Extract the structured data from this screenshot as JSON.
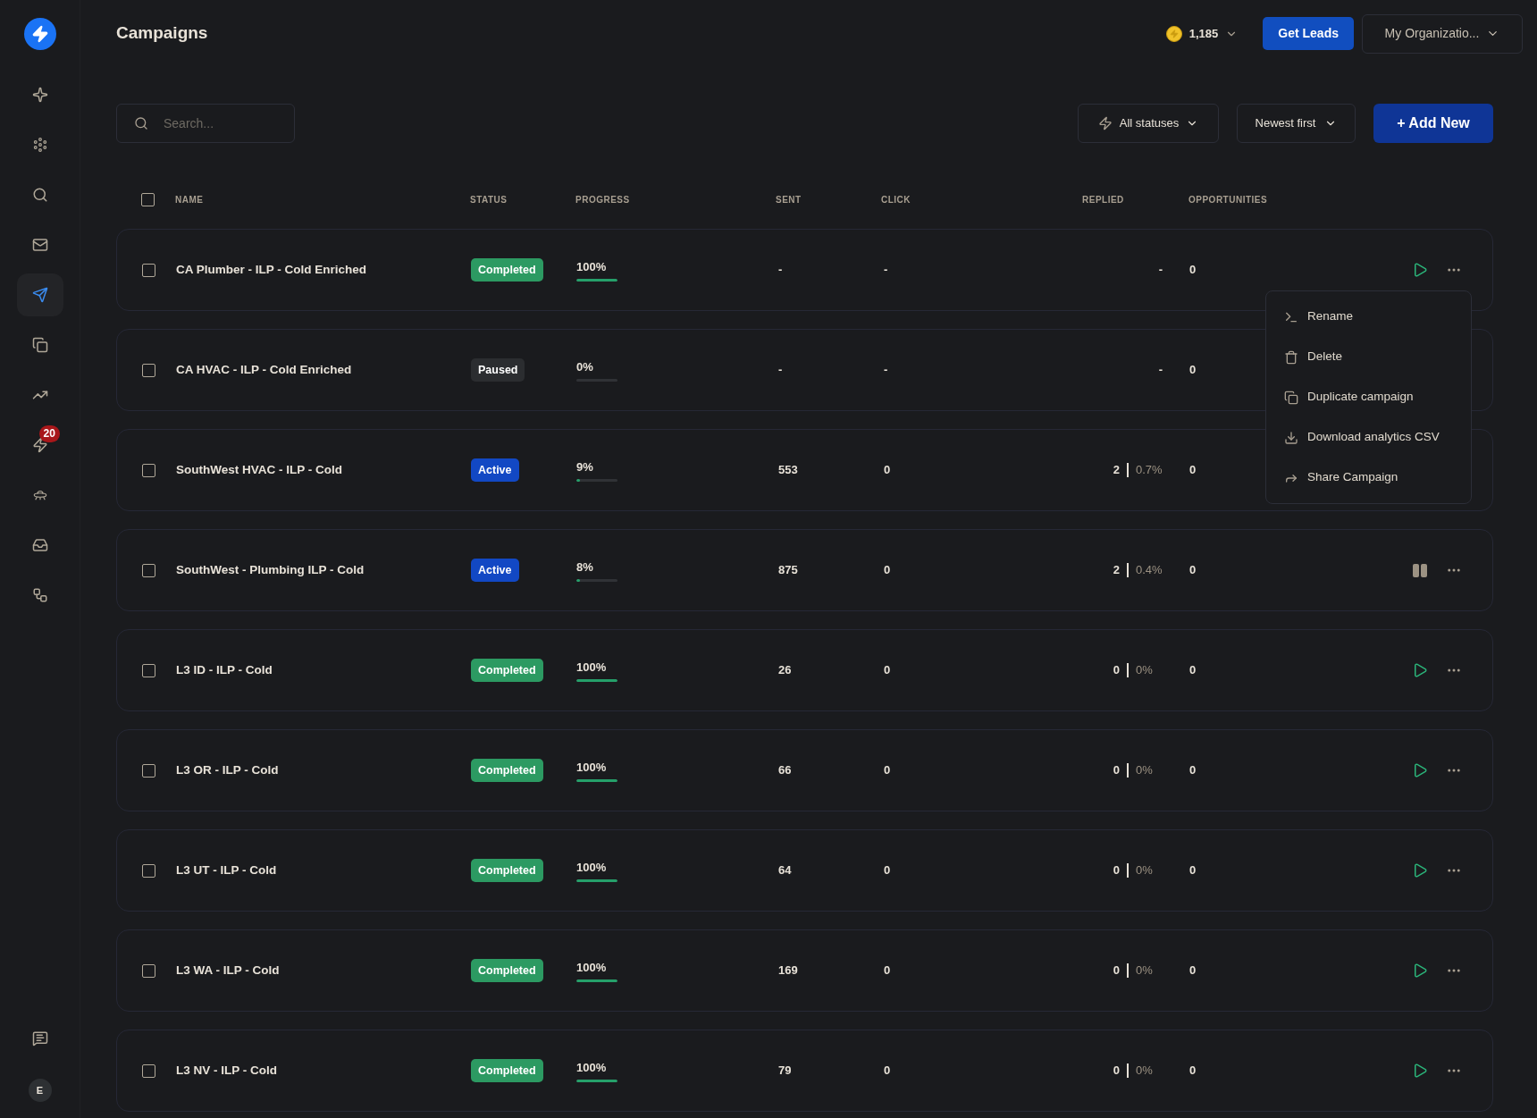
{
  "sidebar": {
    "items": [
      {
        "selected": false
      },
      {
        "selected": false
      },
      {
        "selected": false
      },
      {
        "selected": false
      },
      {
        "selected": true
      },
      {
        "selected": false
      },
      {
        "selected": false
      },
      {
        "selected": false,
        "badge": "20"
      },
      {
        "selected": false
      },
      {
        "selected": false
      },
      {
        "selected": false
      }
    ],
    "avatar": "E"
  },
  "header": {
    "title": "Campaigns",
    "credits": "1,185",
    "get_leads": "Get Leads",
    "organization": "My Organizatio..."
  },
  "toolbar": {
    "search": {
      "placeholder": "Search..."
    },
    "status_filter": "All statuses",
    "sort": "Newest first",
    "add_button": "+ Add New"
  },
  "table": {
    "select_all_checked": false,
    "columns": [
      "NAME",
      "STATUS",
      "PROGRESS",
      "SENT",
      "CLICK",
      "REPLIED",
      "OPPORTUNITIES"
    ],
    "rows": [
      {
        "kind": "completed",
        "checked": false,
        "name": "CA Plumber - ILP - Cold Enriched",
        "status": "Completed",
        "progress": "100%",
        "level": 1,
        "sent": "-",
        "click": "-",
        "replied": "-",
        "opportunities": "0",
        "action": {
          "kind": "play"
        }
      },
      {
        "kind": "paused",
        "checked": false,
        "name": "CA HVAC - ILP - Cold Enriched",
        "status": "Paused",
        "progress": "0%",
        "level": 0,
        "sent": "-",
        "click": "-",
        "replied": "-",
        "opportunities": "0"
      },
      {
        "kind": "active",
        "checked": false,
        "name": "SouthWest HVAC - ILP - Cold",
        "status": "Active",
        "progress": "9%",
        "level": 0.09,
        "sent": "553",
        "click": "0",
        "replied": "2",
        "replied_rate": "0.7%",
        "opportunities": "0"
      },
      {
        "kind": "active",
        "checked": false,
        "name": "SouthWest - Plumbing ILP - Cold",
        "status": "Active",
        "progress": "8%",
        "level": 0.08,
        "sent": "875",
        "click": "0",
        "replied": "2",
        "replied_rate": "0.4%",
        "opportunities": "0",
        "action": {
          "kind": "pause"
        }
      },
      {
        "kind": "completed",
        "checked": false,
        "name": "L3 ID - ILP - Cold",
        "status": "Completed",
        "progress": "100%",
        "level": 1,
        "sent": "26",
        "click": "0",
        "replied": "0",
        "replied_rate": "0%",
        "opportunities": "0",
        "action": {
          "kind": "play"
        }
      },
      {
        "kind": "completed",
        "checked": false,
        "name": "L3 OR - ILP - Cold",
        "status": "Completed",
        "progress": "100%",
        "level": 1,
        "sent": "66",
        "click": "0",
        "replied": "0",
        "replied_rate": "0%",
        "opportunities": "0",
        "action": {
          "kind": "play"
        }
      },
      {
        "kind": "completed",
        "checked": false,
        "name": "L3 UT - ILP - Cold",
        "status": "Completed",
        "progress": "100%",
        "level": 1,
        "sent": "64",
        "click": "0",
        "replied": "0",
        "replied_rate": "0%",
        "opportunities": "0",
        "action": {
          "kind": "play"
        }
      },
      {
        "kind": "completed",
        "checked": false,
        "name": "L3 WA - ILP - Cold",
        "status": "Completed",
        "progress": "100%",
        "level": 1,
        "sent": "169",
        "click": "0",
        "replied": "0",
        "replied_rate": "0%",
        "opportunities": "0",
        "action": {
          "kind": "play"
        }
      },
      {
        "kind": "completed",
        "checked": false,
        "name": "L3 NV - ILP - Cold",
        "status": "Completed",
        "progress": "100%",
        "level": 1,
        "sent": "79",
        "click": "0",
        "replied": "0",
        "replied_rate": "0%",
        "opportunities": "0",
        "action": {
          "kind": "play"
        }
      }
    ]
  },
  "context_menu": {
    "items": [
      "Rename",
      "Delete",
      "Duplicate campaign",
      "Download analytics CSV",
      "Share Campaign"
    ]
  }
}
